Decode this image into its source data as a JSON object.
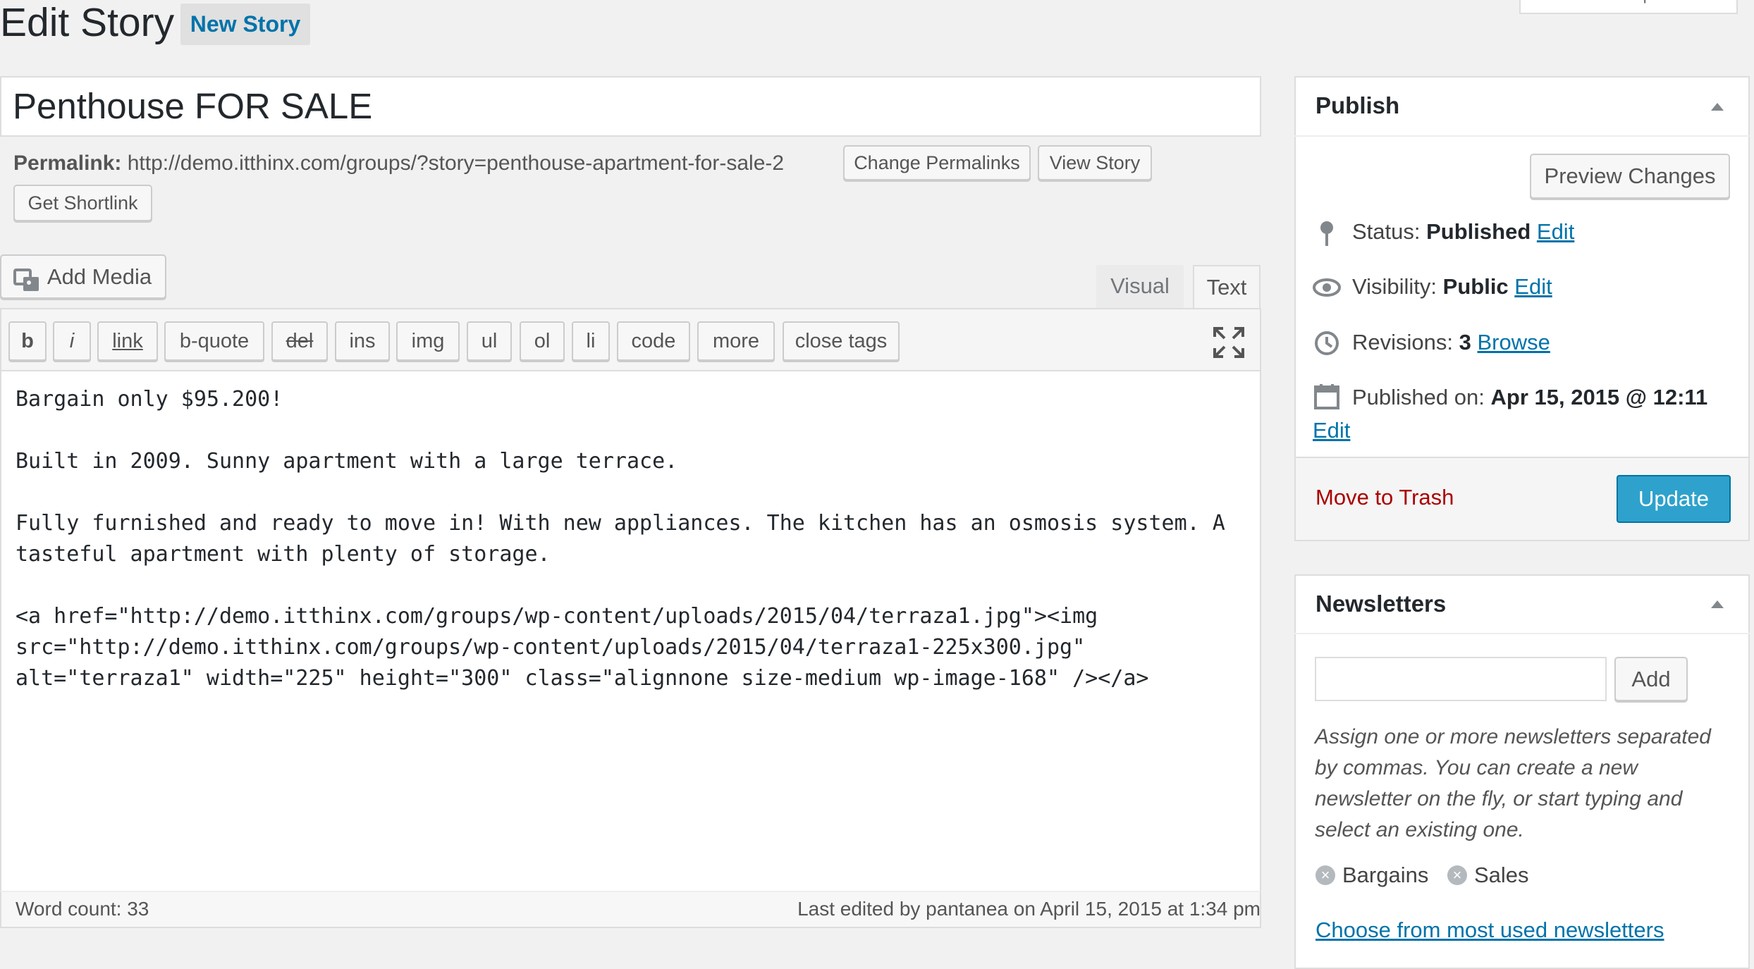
{
  "header": {
    "title": "Edit Story",
    "add_new_label": "New Story",
    "screen_options_label": "Screen Options"
  },
  "post": {
    "title_value": "Penthouse FOR SALE",
    "permalink_label": "Permalink:",
    "permalink_url": "http://demo.itthinx.com/groups/?story=penthouse-apartment-for-sale-2",
    "change_permalinks_label": "Change Permalinks",
    "view_story_label": "View Story",
    "get_shortlink_label": "Get Shortlink"
  },
  "editor": {
    "add_media_label": "Add Media",
    "tabs": {
      "visual": "Visual",
      "text": "Text"
    },
    "quicktags": [
      "b",
      "i",
      "link",
      "b-quote",
      "del",
      "ins",
      "img",
      "ul",
      "ol",
      "li",
      "code",
      "more",
      "close tags"
    ],
    "content": "Bargain only $95.200!\n\nBuilt in 2009. Sunny apartment with a large terrace.\n\nFully furnished and ready to move in! With new appliances. The kitchen has an osmosis system. A\ntasteful apartment with plenty of storage.\n\n<a href=\"http://demo.itthinx.com/groups/wp-content/uploads/2015/04/terraza1.jpg\"><img\nsrc=\"http://demo.itthinx.com/groups/wp-content/uploads/2015/04/terraza1-225x300.jpg\"\nalt=\"terraza1\" width=\"225\" height=\"300\" class=\"alignnone size-medium wp-image-168\" /></a>",
    "word_count": "Word count: 33",
    "last_edited": "Last edited by pantanea on April 15, 2015 at 1:34 pm"
  },
  "publish": {
    "title": "Publish",
    "preview_label": "Preview Changes",
    "status_label": "Status:",
    "status_value": "Published",
    "visibility_label": "Visibility:",
    "visibility_value": "Public",
    "revisions_label": "Revisions:",
    "revisions_value": "3",
    "browse_label": "Browse",
    "published_on_label": "Published on:",
    "published_on_value": "Apr 15, 2015 @ 12:11",
    "edit_label": "Edit",
    "trash_label": "Move to Trash",
    "update_label": "Update"
  },
  "newsletters": {
    "title": "Newsletters",
    "input_value": "",
    "add_label": "Add",
    "hint": "Assign one or more newsletters separated by commas. You can create a new newsletter on the fly, or start typing and select an existing one.",
    "tags": [
      "Bargains",
      "Sales"
    ],
    "most_used_label": "Choose from most used newsletters"
  },
  "colors": {
    "accent": "#0073aa",
    "update_button": "#2ea2cc",
    "trash": "#aa0000"
  }
}
